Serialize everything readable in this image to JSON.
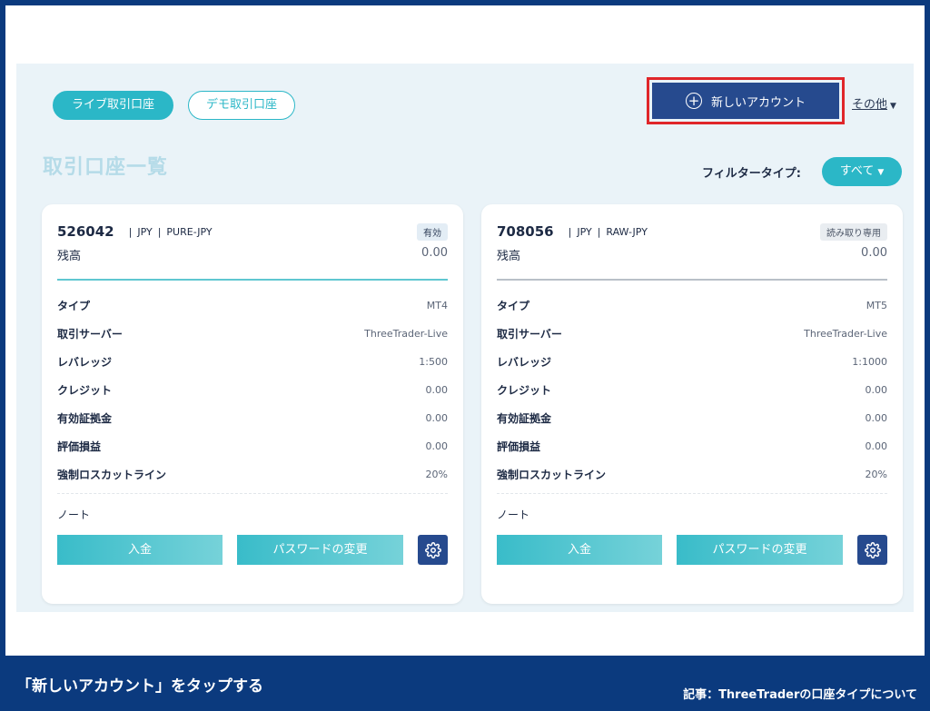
{
  "header": {
    "tabs": [
      {
        "label": "ライブ取引口座",
        "active": true
      },
      {
        "label": "デモ取引口座",
        "active": false
      }
    ],
    "new_account_label": "新しいアカウント",
    "other_label": "その他",
    "title": "取引口座一覧",
    "filter_label": "フィルタータイプ:",
    "filter_value": "すべて"
  },
  "colors": {
    "accent": "#2bb7c7",
    "primary_dark": "#264a8e",
    "highlight_border": "#e0262a",
    "frame_blue": "#0b3a7e"
  },
  "accounts": [
    {
      "number": "526042",
      "currency": "JPY",
      "group": "PURE-JPY",
      "status": "有効",
      "balance_label": "残高",
      "balance": "0.00",
      "details": [
        {
          "label": "タイプ",
          "value": "MT4"
        },
        {
          "label": "取引サーバー",
          "value": "ThreeTrader-Live"
        },
        {
          "label": "レバレッジ",
          "value": "1:500"
        },
        {
          "label": "クレジット",
          "value": "0.00"
        },
        {
          "label": "有効証拠金",
          "value": "0.00"
        },
        {
          "label": "評価損益",
          "value": "0.00"
        },
        {
          "label": "強制ロスカットライン",
          "value": "20%"
        }
      ],
      "note_label": "ノート",
      "deposit_label": "入金",
      "password_label": "パスワードの変更"
    },
    {
      "number": "708056",
      "currency": "JPY",
      "group": "RAW-JPY",
      "status": "読み取り専用",
      "balance_label": "残高",
      "balance": "0.00",
      "details": [
        {
          "label": "タイプ",
          "value": "MT5"
        },
        {
          "label": "取引サーバー",
          "value": "ThreeTrader-Live"
        },
        {
          "label": "レバレッジ",
          "value": "1:1000"
        },
        {
          "label": "クレジット",
          "value": "0.00"
        },
        {
          "label": "有効証拠金",
          "value": "0.00"
        },
        {
          "label": "評価損益",
          "value": "0.00"
        },
        {
          "label": "強制ロスカットライン",
          "value": "20%"
        }
      ],
      "note_label": "ノート",
      "deposit_label": "入金",
      "password_label": "パスワードの変更"
    }
  ],
  "caption": "「新しいアカウント」をタップする",
  "article": "記事：ThreeTraderの口座タイプについて"
}
